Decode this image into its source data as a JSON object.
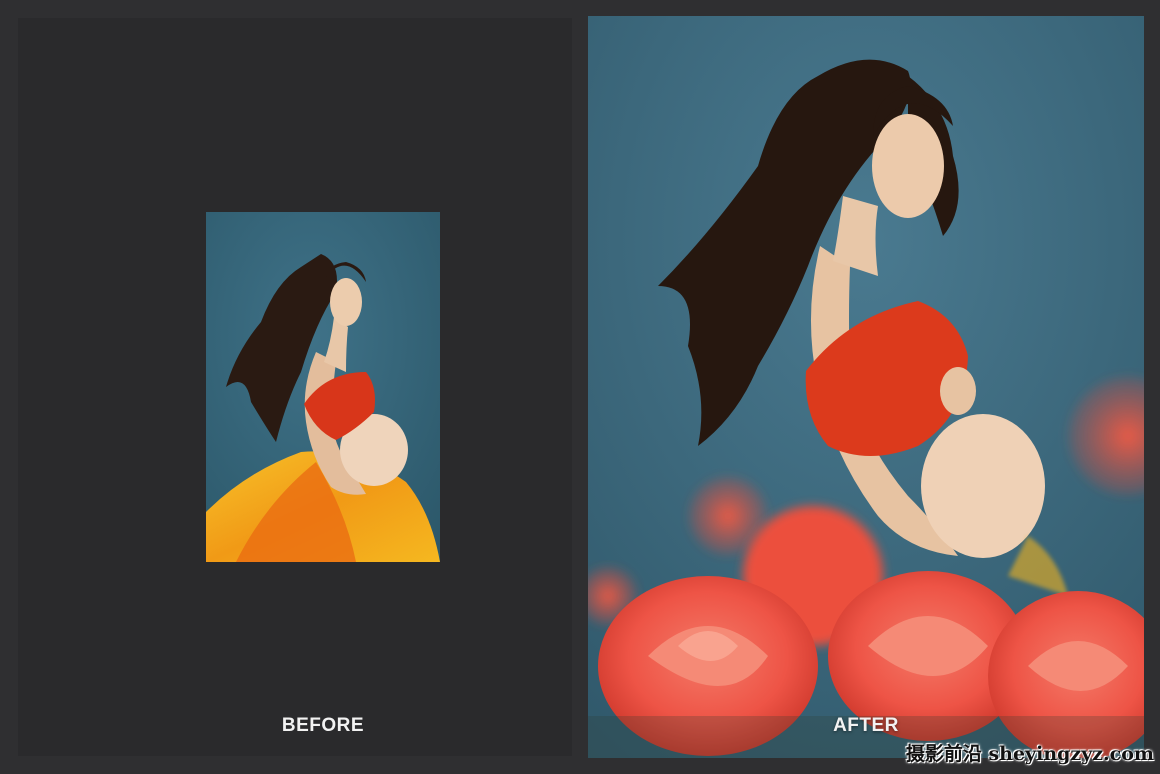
{
  "before": {
    "label": "BEFORE"
  },
  "after": {
    "label": "AFTER"
  },
  "watermark": {
    "text": "摄影前沿 sheyingzyz.com"
  },
  "colors": {
    "background": "#2f2f31",
    "panel": "#2a2a2c",
    "backdrop_blue": "#3c6478",
    "top_red": "#e0401e",
    "skirt_yellow": "#f2b51d",
    "rose_red": "#f0584a",
    "hair": "#2a1a12",
    "skin": "#e8c7a8"
  }
}
